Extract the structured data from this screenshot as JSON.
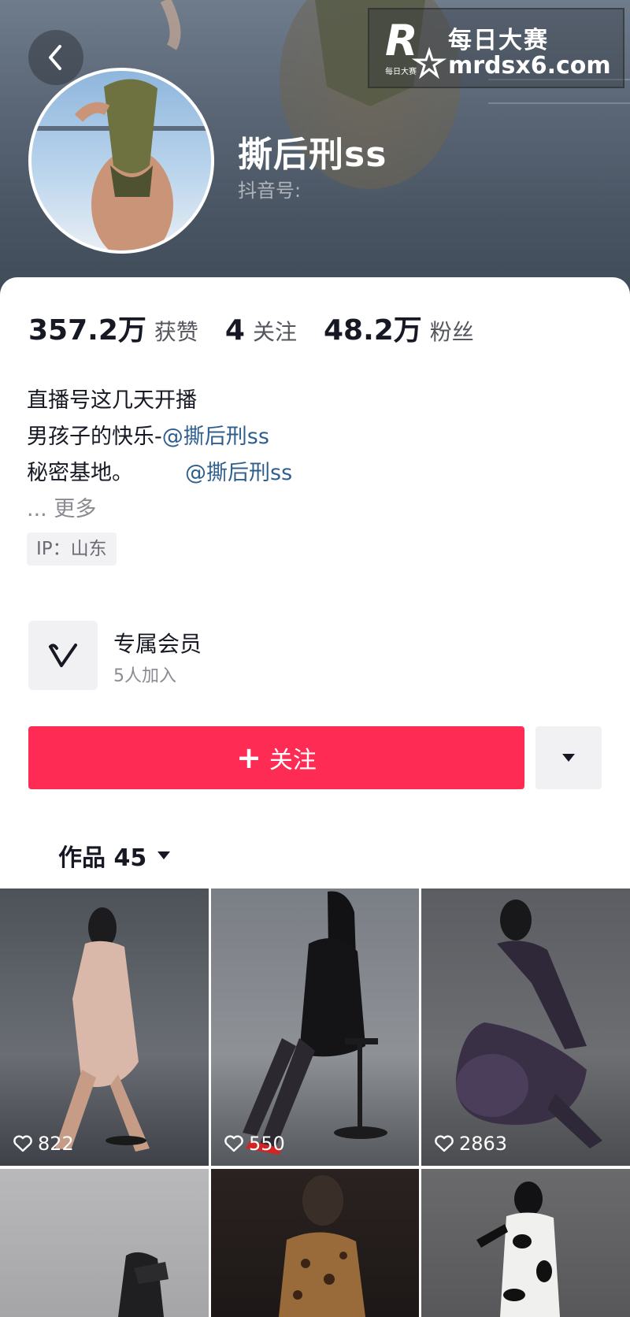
{
  "profile": {
    "nickname": "撕后刑ss",
    "douyin_id_label": "抖音号:"
  },
  "watermark": {
    "logo_text": "R",
    "logo_sub": "每日大赛",
    "title": "每日大赛",
    "url": "mrdsx6.com"
  },
  "stats": [
    {
      "value": "357.2万",
      "label": "获赞"
    },
    {
      "value": "4",
      "label": "关注"
    },
    {
      "value": "48.2万",
      "label": "粉丝"
    }
  ],
  "bio": {
    "line1": "直播号这几天开播",
    "line2_text": "男孩子的快乐-",
    "line2_mention": "@撕后刑ss",
    "line3_text": "秘密基地。",
    "line3_mention": "@撕后刑ss",
    "more_prefix": "...",
    "more_label": "更多"
  },
  "ip": "IP：山东",
  "member": {
    "title": "专属会员",
    "subtitle": "5人加入"
  },
  "follow_button": {
    "plus": "+",
    "label": "关注"
  },
  "works_tab": {
    "label": "作品 45"
  },
  "posts": [
    {
      "likes": "822"
    },
    {
      "likes": "550"
    },
    {
      "likes": "2863"
    },
    {
      "likes": ""
    },
    {
      "likes": ""
    },
    {
      "likes": ""
    }
  ],
  "colors": {
    "accent": "#fe2c55",
    "mention": "#2f5f8e"
  }
}
